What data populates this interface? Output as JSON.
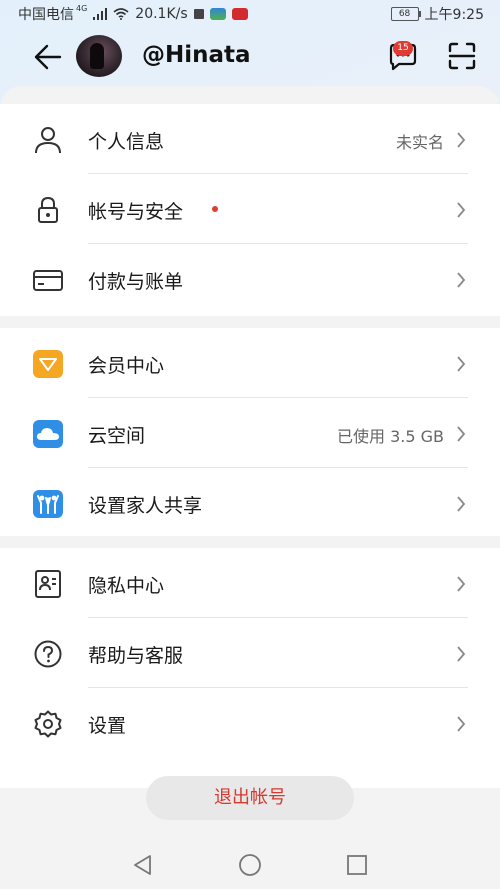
{
  "status_bar": {
    "carrier": "中国电信",
    "network": "4G",
    "speed": "20.1K/s",
    "battery": "68",
    "time": "上午9:25"
  },
  "header": {
    "username": "@Hinata",
    "message_badge": "15"
  },
  "menu": {
    "group1": [
      {
        "label": "个人信息",
        "value": "未实名"
      },
      {
        "label": "帐号与安全",
        "value": ""
      },
      {
        "label": "付款与账单",
        "value": ""
      }
    ],
    "group2": [
      {
        "label": "会员中心",
        "value": ""
      },
      {
        "label": "云空间",
        "value": "已使用 3.5 GB"
      },
      {
        "label": "设置家人共享",
        "value": ""
      }
    ],
    "group3": [
      {
        "label": "隐私中心",
        "value": ""
      },
      {
        "label": "帮助与客服",
        "value": ""
      },
      {
        "label": "设置",
        "value": ""
      }
    ]
  },
  "logout_label": "退出帐号",
  "colors": {
    "accent_red": "#d43a30",
    "badge_red": "#e03a32"
  }
}
